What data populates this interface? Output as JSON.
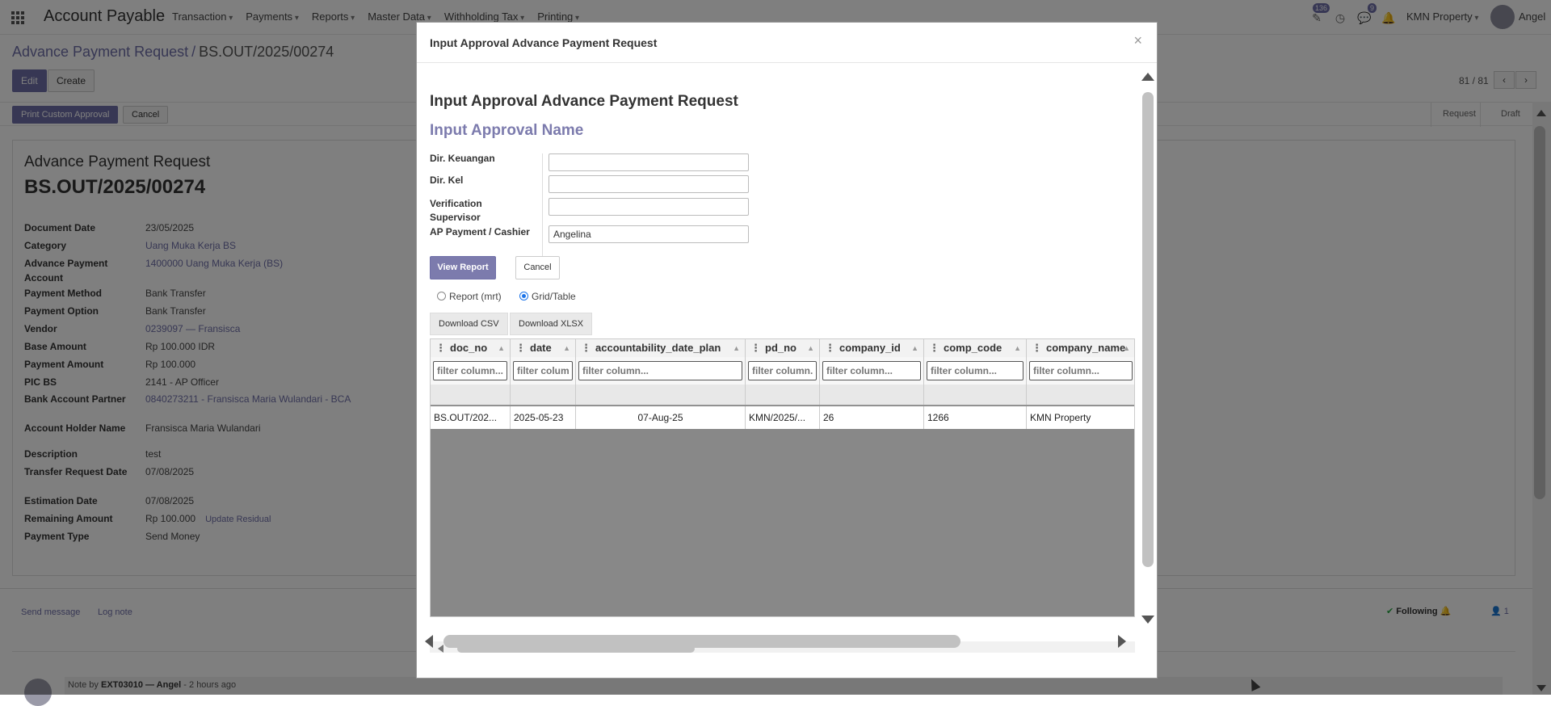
{
  "navbar": {
    "app_title": "Account Payable",
    "menu": [
      "Transaction",
      "Payments",
      "Reports",
      "Master Data",
      "Withholding Tax",
      "Printing"
    ],
    "activity_badge": "136",
    "messages_badge": "9",
    "company": "KMN Property",
    "user": "Angel"
  },
  "control_panel": {
    "breadcrumb_parent": "Advance Payment Request",
    "breadcrumb_sep": "/",
    "breadcrumb_current": "BS.OUT/2025/00274",
    "edit_label": "Edit",
    "create_label": "Create",
    "print_label": "Print Custom Approval",
    "cancel_label": "Cancel",
    "pager": "81 / 81",
    "stages": [
      "Request",
      "Draft"
    ]
  },
  "form": {
    "title": "Advance Payment Request",
    "reference": "BS.OUT/2025/00274",
    "fields": [
      {
        "label": "Document Date",
        "value": "23/05/2025",
        "link": false
      },
      {
        "label": "Category",
        "value": "Uang Muka Kerja BS",
        "link": true
      },
      {
        "label": "Advance Payment Account",
        "value": "1400000 Uang Muka Kerja (BS)",
        "link": true
      },
      {
        "label": "Payment Method",
        "value": "Bank Transfer",
        "link": false
      },
      {
        "label": "Payment Option",
        "value": "Bank Transfer",
        "link": false
      },
      {
        "label": "Vendor",
        "value": "0239097 — Fransisca",
        "link": true
      },
      {
        "label": "Base Amount",
        "value": "Rp 100.000 IDR",
        "link": false
      },
      {
        "label": "Payment Amount",
        "value": "Rp 100.000",
        "link": false
      },
      {
        "label": "PIC BS",
        "value": "2141 - AP Officer",
        "link": false
      },
      {
        "label": "Bank Account Partner",
        "value": "0840273211 - Fransisca Maria Wulandari - BCA",
        "link": true
      },
      {
        "label": "Account Holder Name",
        "value": "Fransisca Maria Wulandari",
        "link": false
      },
      {
        "label": "Description",
        "value": "test",
        "link": false
      },
      {
        "label": "Transfer Request Date",
        "value": "07/08/2025",
        "link": false
      },
      {
        "label": "Estimation Date",
        "value": "07/08/2025",
        "link": false
      },
      {
        "label": "Remaining Amount",
        "value": "Rp 100.000",
        "link": false
      },
      {
        "label": "Payment Type",
        "value": "Send Money",
        "link": false
      }
    ],
    "update_residual_label": "Update Residual"
  },
  "chatter": {
    "send_message": "Send message",
    "log_note": "Log note",
    "following": "Following",
    "followers_count": "1",
    "note_prefix": "Note by",
    "note_author": "EXT03010 — Angel",
    "note_time": "- 2 hours ago"
  },
  "modal": {
    "title": "Input Approval Advance Payment Request",
    "heading": "Input Approval Advance Payment Request",
    "subheading": "Input Approval Name",
    "inputs": [
      {
        "label": "Dir. Keuangan",
        "value": ""
      },
      {
        "label": "Dir. Kel",
        "value": ""
      },
      {
        "label": "Verification Supervisor",
        "value": ""
      },
      {
        "label": "AP Payment / Cashier",
        "value": "Angelina"
      }
    ],
    "view_report_label": "View Report",
    "cancel_label": "Cancel",
    "radio_report": "Report (mrt)",
    "radio_grid": "Grid/Table",
    "radio_selected": "Grid/Table",
    "download_csv": "Download CSV",
    "download_xlsx": "Download XLSX",
    "grid": {
      "columns": [
        {
          "name": "doc_no",
          "filter_placeholder": "filter column..."
        },
        {
          "name": "date",
          "filter_placeholder": "filter column..."
        },
        {
          "name": "accountability_date_plan",
          "filter_placeholder": "filter column..."
        },
        {
          "name": "pd_no",
          "filter_placeholder": "filter column..."
        },
        {
          "name": "company_id",
          "filter_placeholder": "filter column..."
        },
        {
          "name": "comp_code",
          "filter_placeholder": "filter column..."
        },
        {
          "name": "company_name",
          "filter_placeholder": "filter column..."
        }
      ],
      "rows": [
        [
          "BS.OUT/202...",
          "2025-05-23",
          "07-Aug-25",
          "KMN/2025/...",
          "26",
          "1266",
          "KMN Property"
        ]
      ]
    }
  }
}
